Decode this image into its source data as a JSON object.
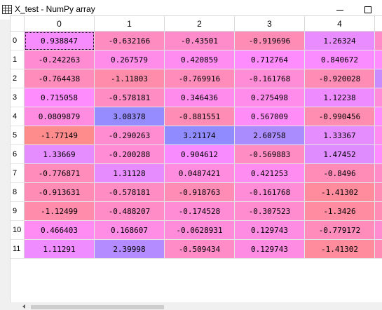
{
  "window": {
    "title": "X_test - NumPy array",
    "icon": "table-grid-icon"
  },
  "columns": [
    "0",
    "1",
    "2",
    "3",
    "4"
  ],
  "rows": [
    {
      "index": "0",
      "values": [
        "0.938847",
        "-0.632166",
        "-0.43501",
        "-0.919696",
        "1.26324"
      ]
    },
    {
      "index": "1",
      "values": [
        "-0.242263",
        "0.267579",
        "0.420859",
        "0.712764",
        "0.840672"
      ]
    },
    {
      "index": "2",
      "values": [
        "-0.764438",
        "-1.11803",
        "-0.769916",
        "-0.161768",
        "-0.920028"
      ]
    },
    {
      "index": "3",
      "values": [
        "0.715058",
        "-0.578181",
        "0.346436",
        "0.275498",
        "1.12238"
      ]
    },
    {
      "index": "4",
      "values": [
        "0.0809879",
        "3.08378",
        "-0.881551",
        "0.567009",
        "-0.990456"
      ]
    },
    {
      "index": "5",
      "values": [
        "-1.77149",
        "-0.290263",
        "3.21174",
        "2.60758",
        "1.33367"
      ]
    },
    {
      "index": "6",
      "values": [
        "1.33669",
        "-0.200288",
        "0.904612",
        "-0.569883",
        "1.47452"
      ]
    },
    {
      "index": "7",
      "values": [
        "-0.776871",
        "1.31128",
        "0.0487421",
        "0.421253",
        "-0.8496"
      ]
    },
    {
      "index": "8",
      "values": [
        "-0.913631",
        "-0.578181",
        "-0.918763",
        "-0.161768",
        "-1.41302"
      ]
    },
    {
      "index": "9",
      "values": [
        "-1.12499",
        "-0.488207",
        "-0.174528",
        "-0.307523",
        "-1.3426"
      ]
    },
    {
      "index": "10",
      "values": [
        "0.466403",
        "0.168607",
        "-0.0628931",
        "0.129743",
        "-0.779172"
      ]
    },
    {
      "index": "11",
      "values": [
        "1.11291",
        "2.39998",
        "-0.509434",
        "0.129743",
        "-1.41302"
      ]
    }
  ],
  "selected_cell": {
    "row": 0,
    "col": 0
  },
  "colormap": {
    "min": -1.8,
    "max": 3.3,
    "low_color": "#ff8c8c",
    "mid_color": "#ff8cff",
    "high_color": "#8c8cff"
  },
  "extra_column_colors": [
    "#ff8cc8",
    "#ff8cff",
    "#c88cff",
    "#ff8cd8",
    "#ff8cff",
    "#ff8cf0",
    "#ff8cff",
    "#ff8cc8",
    "#ff8cb4",
    "#ff8cb4",
    "#ff8cd0",
    "#ff8cb4"
  ]
}
